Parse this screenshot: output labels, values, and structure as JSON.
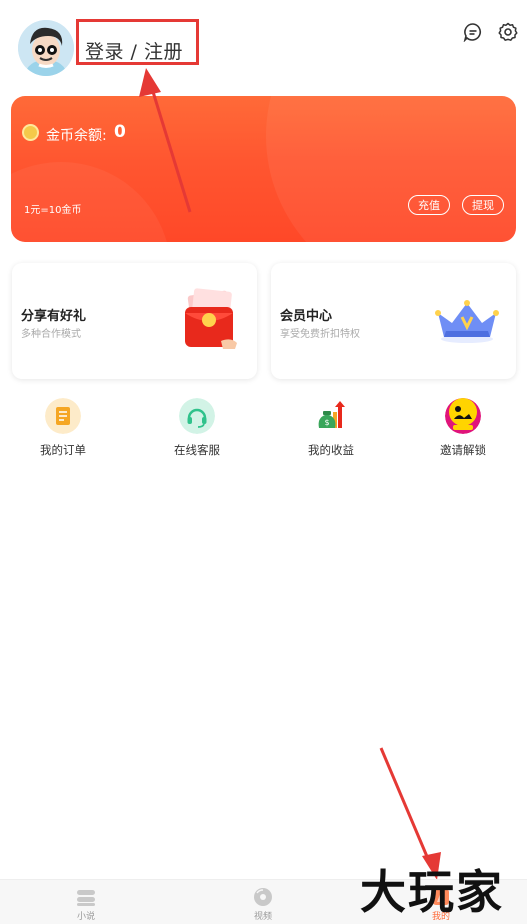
{
  "header": {
    "login_text": "登录 / 注册",
    "icons": [
      "message-icon",
      "settings-icon"
    ]
  },
  "gold_card": {
    "balance_label": "金币余额:",
    "balance_value": "0",
    "exchange_rate": "1元=10金币",
    "recharge_label": "充值",
    "withdraw_label": "提现",
    "gradient_colors": [
      "#ff6a38",
      "#ff4828"
    ]
  },
  "promos": [
    {
      "title": "分享有好礼",
      "subtitle": "多种合作模式",
      "icon": "red-envelope-icon"
    },
    {
      "title": "会员中心",
      "subtitle": "享受免费折扣特权",
      "icon": "crown-icon"
    }
  ],
  "quick_actions": [
    {
      "label": "我的订单",
      "icon": "order-icon",
      "color": "#f5a623"
    },
    {
      "label": "在线客服",
      "icon": "headset-icon",
      "color": "#2fc28b"
    },
    {
      "label": "我的收益",
      "icon": "money-bag-icon",
      "color": "#f5a623"
    },
    {
      "label": "邀请解锁",
      "icon": "invite-unlock-icon",
      "color": "#e0147a"
    }
  ],
  "tabbar": {
    "items": [
      {
        "label": "小说",
        "icon": "book-stack-icon"
      },
      {
        "label": "视频",
        "icon": "video-disc-icon"
      },
      {
        "label": "我的",
        "icon": "profile-icon"
      }
    ],
    "active_color": "#ff6a38",
    "inactive_color": "#999999"
  },
  "annotation_color": "#e53935",
  "watermark": "大玩家"
}
